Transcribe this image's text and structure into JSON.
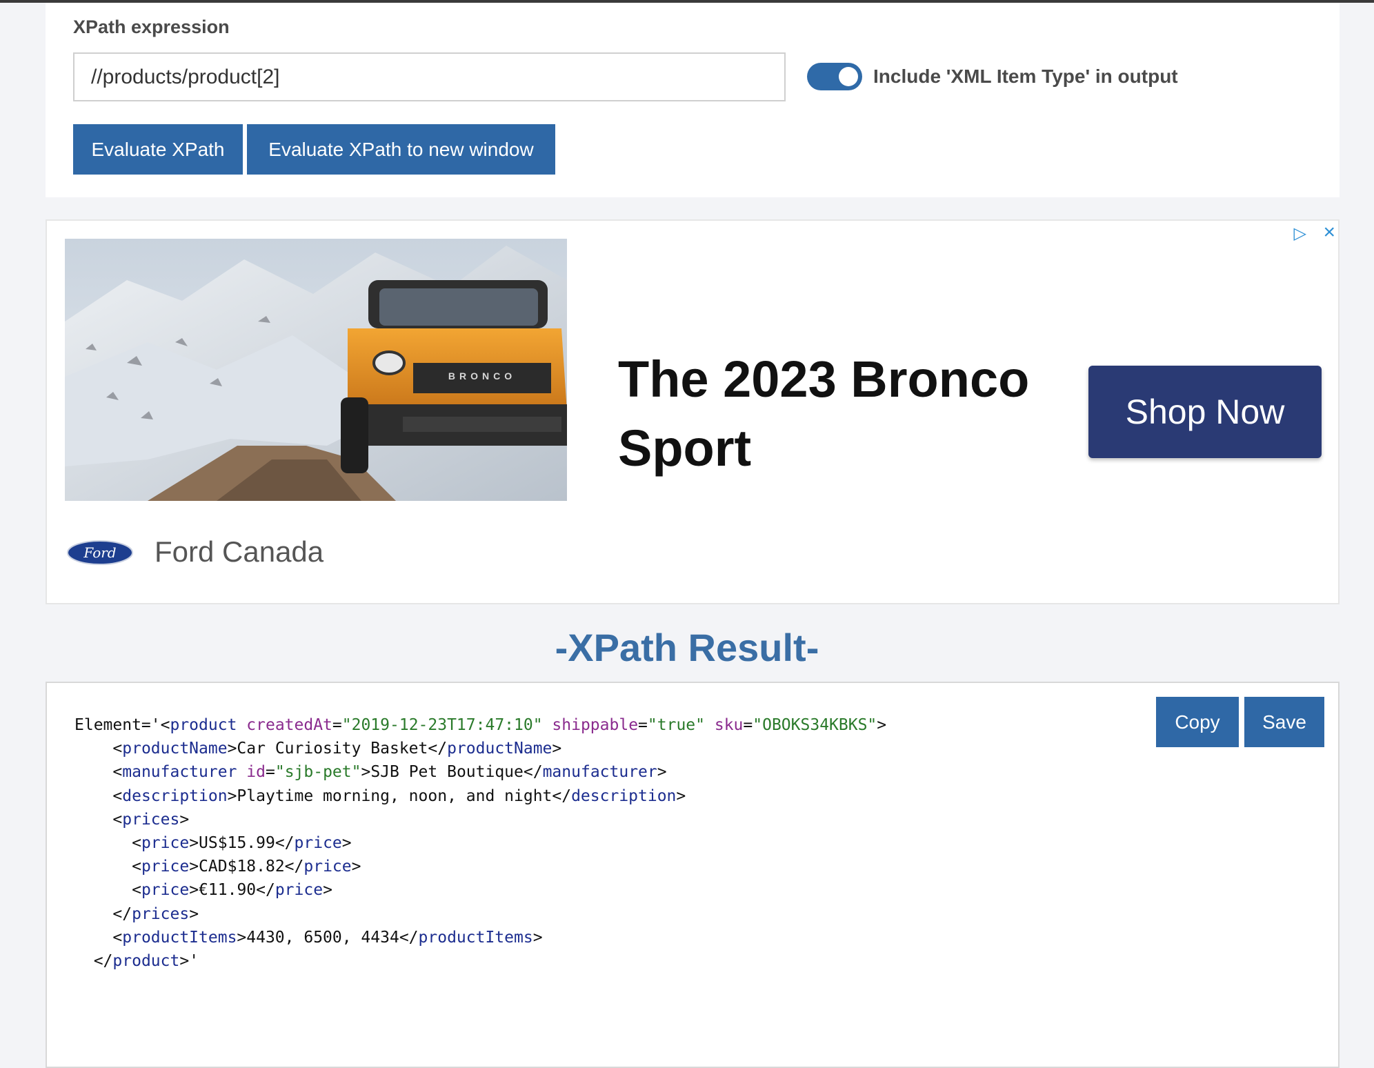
{
  "xpath": {
    "label": "XPath expression",
    "input_value": "//products/product[2]",
    "toggle_label": "Include 'XML Item Type' in output",
    "toggle_on": true,
    "evaluate_button": "Evaluate XPath",
    "evaluate_new_window_button": "Evaluate XPath to new window"
  },
  "ad": {
    "headline": "The 2023 Bronco Sport",
    "cta": "Shop Now",
    "advertiser": "Ford Canada",
    "logo_text": "Ford"
  },
  "result": {
    "title": "-XPath Result-",
    "copy_button": "Copy",
    "save_button": "Save",
    "lines": [
      {
        "indent": 0,
        "tokens": [
          {
            "t": "p",
            "v": "Element='<"
          },
          {
            "t": "tag",
            "v": "product"
          },
          {
            "t": "p",
            "v": " "
          },
          {
            "t": "attr",
            "v": "createdAt"
          },
          {
            "t": "p",
            "v": "="
          },
          {
            "t": "val",
            "v": "\"2019-12-23T17:47:10\""
          },
          {
            "t": "p",
            "v": " "
          },
          {
            "t": "attr",
            "v": "shippable"
          },
          {
            "t": "p",
            "v": "="
          },
          {
            "t": "val",
            "v": "\"true\""
          },
          {
            "t": "p",
            "v": " "
          },
          {
            "t": "attr",
            "v": "sku"
          },
          {
            "t": "p",
            "v": "="
          },
          {
            "t": "val",
            "v": "\"OBOKS34KBKS\""
          },
          {
            "t": "p",
            "v": ">"
          }
        ]
      },
      {
        "indent": 4,
        "tokens": [
          {
            "t": "p",
            "v": "<"
          },
          {
            "t": "tag",
            "v": "productName"
          },
          {
            "t": "p",
            "v": ">Car Curiosity Basket</"
          },
          {
            "t": "tag",
            "v": "productName"
          },
          {
            "t": "p",
            "v": ">"
          }
        ]
      },
      {
        "indent": 4,
        "tokens": [
          {
            "t": "p",
            "v": "<"
          },
          {
            "t": "tag",
            "v": "manufacturer"
          },
          {
            "t": "p",
            "v": " "
          },
          {
            "t": "attr",
            "v": "id"
          },
          {
            "t": "p",
            "v": "="
          },
          {
            "t": "val",
            "v": "\"sjb-pet\""
          },
          {
            "t": "p",
            "v": ">SJB Pet Boutique</"
          },
          {
            "t": "tag",
            "v": "manufacturer"
          },
          {
            "t": "p",
            "v": ">"
          }
        ]
      },
      {
        "indent": 4,
        "tokens": [
          {
            "t": "p",
            "v": "<"
          },
          {
            "t": "tag",
            "v": "description"
          },
          {
            "t": "p",
            "v": ">Playtime morning, noon, and night</"
          },
          {
            "t": "tag",
            "v": "description"
          },
          {
            "t": "p",
            "v": ">"
          }
        ]
      },
      {
        "indent": 4,
        "tokens": [
          {
            "t": "p",
            "v": "<"
          },
          {
            "t": "tag",
            "v": "prices"
          },
          {
            "t": "p",
            "v": ">"
          }
        ]
      },
      {
        "indent": 6,
        "tokens": [
          {
            "t": "p",
            "v": "<"
          },
          {
            "t": "tag",
            "v": "price"
          },
          {
            "t": "p",
            "v": ">US$15.99</"
          },
          {
            "t": "tag",
            "v": "price"
          },
          {
            "t": "p",
            "v": ">"
          }
        ]
      },
      {
        "indent": 6,
        "tokens": [
          {
            "t": "p",
            "v": "<"
          },
          {
            "t": "tag",
            "v": "price"
          },
          {
            "t": "p",
            "v": ">CAD$18.82</"
          },
          {
            "t": "tag",
            "v": "price"
          },
          {
            "t": "p",
            "v": ">"
          }
        ]
      },
      {
        "indent": 6,
        "tokens": [
          {
            "t": "p",
            "v": "<"
          },
          {
            "t": "tag",
            "v": "price"
          },
          {
            "t": "p",
            "v": ">€11.90</"
          },
          {
            "t": "tag",
            "v": "price"
          },
          {
            "t": "p",
            "v": ">"
          }
        ]
      },
      {
        "indent": 4,
        "tokens": [
          {
            "t": "p",
            "v": "</"
          },
          {
            "t": "tag",
            "v": "prices"
          },
          {
            "t": "p",
            "v": ">"
          }
        ]
      },
      {
        "indent": 4,
        "tokens": [
          {
            "t": "p",
            "v": "<"
          },
          {
            "t": "tag",
            "v": "productItems"
          },
          {
            "t": "p",
            "v": ">4430, 6500, 4434</"
          },
          {
            "t": "tag",
            "v": "productItems"
          },
          {
            "t": "p",
            "v": ">"
          }
        ]
      },
      {
        "indent": 2,
        "tokens": [
          {
            "t": "p",
            "v": "</"
          },
          {
            "t": "tag",
            "v": "product"
          },
          {
            "t": "p",
            "v": ">'"
          }
        ]
      }
    ]
  },
  "colors": {
    "accent_blue": "#2f68a6",
    "title_blue": "#3a6ea5",
    "cta_navy": "#2a3a74",
    "xml_tag": "#1c2d8f",
    "xml_attr": "#8a2b8e",
    "xml_value": "#2a7a2a"
  },
  "icons": [
    "adchoices-icon",
    "close-icon",
    "ford-logo"
  ]
}
